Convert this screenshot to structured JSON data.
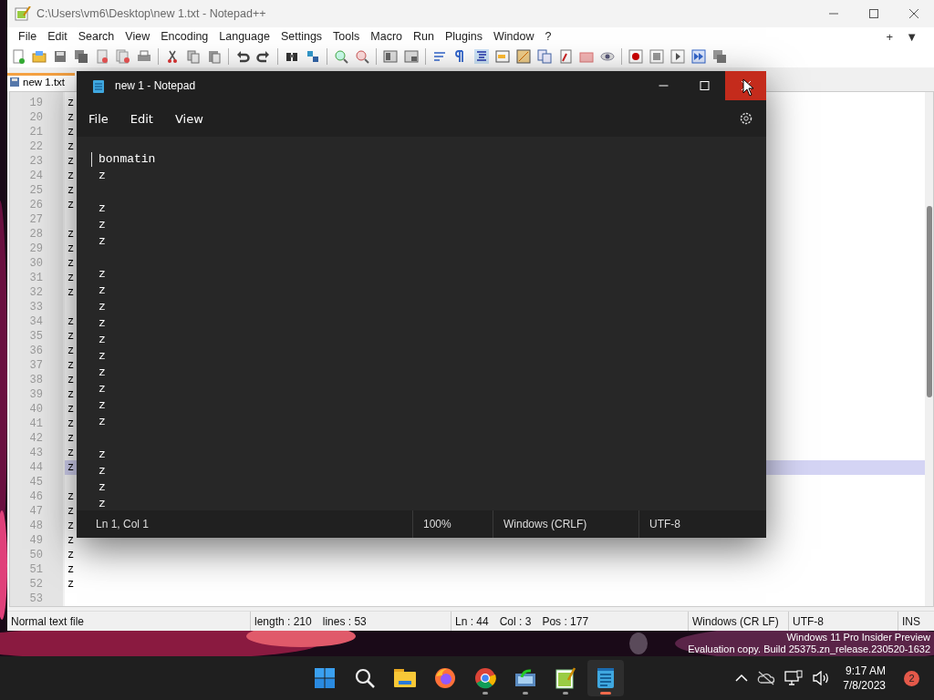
{
  "notepadpp": {
    "title": "C:\\Users\\vm6\\Desktop\\new 1.txt - Notepad++",
    "menu": [
      "File",
      "Edit",
      "Search",
      "View",
      "Encoding",
      "Language",
      "Settings",
      "Tools",
      "Macro",
      "Run",
      "Plugins",
      "Window",
      "?"
    ],
    "menu_right": [
      "+",
      "▼"
    ],
    "tabs": [
      {
        "label": "new 1.txt",
        "selected": true
      }
    ],
    "lines": [
      {
        "number": "19",
        "text": "z",
        "current": false
      },
      {
        "number": "20",
        "text": "z",
        "current": false
      },
      {
        "number": "21",
        "text": "z",
        "current": false
      },
      {
        "number": "22",
        "text": "z",
        "current": false
      },
      {
        "number": "23",
        "text": "z",
        "current": false
      },
      {
        "number": "24",
        "text": "z",
        "current": false
      },
      {
        "number": "25",
        "text": "z",
        "current": false
      },
      {
        "number": "26",
        "text": "z",
        "current": false
      },
      {
        "number": "27",
        "current": false
      },
      {
        "number": "28",
        "text": "z",
        "current": false
      },
      {
        "number": "29",
        "text": "z",
        "current": false
      },
      {
        "number": "30",
        "text": "z",
        "current": false
      },
      {
        "number": "31",
        "text": "z",
        "current": false
      },
      {
        "number": "32",
        "text": "z",
        "current": false
      },
      {
        "number": "33",
        "current": false
      },
      {
        "number": "34",
        "text": "z",
        "current": false
      },
      {
        "number": "35",
        "text": "z",
        "current": false
      },
      {
        "number": "36",
        "text": "z",
        "current": false
      },
      {
        "number": "37",
        "text": "z",
        "current": false
      },
      {
        "number": "38",
        "text": "z",
        "current": false
      },
      {
        "number": "39",
        "text": "z",
        "current": false
      },
      {
        "number": "40",
        "text": "z",
        "current": false
      },
      {
        "number": "41",
        "text": "z",
        "current": false
      },
      {
        "number": "42",
        "text": "z",
        "current": false
      },
      {
        "number": "43",
        "text": "z",
        "current": false
      },
      {
        "number": "44",
        "text": "z",
        "current": true
      },
      {
        "number": "45",
        "current": false
      },
      {
        "number": "46",
        "text": "z",
        "current": false
      },
      {
        "number": "47",
        "text": "z",
        "current": false
      },
      {
        "number": "48",
        "text": "z",
        "current": false
      },
      {
        "number": "49",
        "text": "z",
        "current": false
      },
      {
        "number": "50",
        "text": "z",
        "current": false
      },
      {
        "number": "51",
        "text": "z",
        "current": false
      },
      {
        "number": "52",
        "text": "z",
        "current": false
      },
      {
        "number": "53",
        "current": false
      }
    ],
    "status_bar": {
      "file_type": "Normal text file",
      "length": "length : 210",
      "lines": "lines : 53",
      "ln": "Ln : 44",
      "col": "Col : 3",
      "pos": "Pos : 177",
      "eol": "Windows (CR LF)",
      "encoding": "UTF-8",
      "mode": "INS"
    }
  },
  "notepad": {
    "title": "new 1 - Notepad",
    "close_hovered": true,
    "menu": [
      "File",
      "Edit",
      "View"
    ],
    "lines": [
      {
        "kind": "text",
        "text": "bonmatin"
      },
      {
        "kind": "text",
        "text": "z"
      },
      {
        "kind": "blank"
      },
      {
        "kind": "text",
        "text": "z"
      },
      {
        "kind": "text",
        "text": "z"
      },
      {
        "kind": "text",
        "text": "z"
      },
      {
        "kind": "blank"
      },
      {
        "kind": "text",
        "text": "z"
      },
      {
        "kind": "text",
        "text": "z"
      },
      {
        "kind": "text",
        "text": "z"
      },
      {
        "kind": "text",
        "text": "z"
      },
      {
        "kind": "text",
        "text": "z"
      },
      {
        "kind": "text",
        "text": "z"
      },
      {
        "kind": "text",
        "text": "z"
      },
      {
        "kind": "text",
        "text": "z"
      },
      {
        "kind": "text",
        "text": "z"
      },
      {
        "kind": "text",
        "text": "z"
      },
      {
        "kind": "blank"
      },
      {
        "kind": "text",
        "text": "z"
      },
      {
        "kind": "text",
        "text": "z"
      },
      {
        "kind": "text",
        "text": "z"
      },
      {
        "kind": "text",
        "text": "z"
      }
    ],
    "status_bar": {
      "position": "Ln 1, Col 1",
      "zoom": "100%",
      "eol": "Windows (CRLF)",
      "encoding": "UTF-8"
    }
  },
  "desktop": {
    "watermark": [
      "Windows 11 Pro Insider Preview",
      "Evaluation copy. Build 25375.zn_release.230520-1632"
    ]
  },
  "taskbar": {
    "apps": [
      {
        "kind": "start",
        "running": false,
        "selected": false
      },
      {
        "kind": "search",
        "running": false,
        "selected": false
      },
      {
        "kind": "explorer",
        "running": false,
        "selected": false
      },
      {
        "kind": "firefox",
        "running": false,
        "selected": false
      },
      {
        "kind": "chrome",
        "running": true,
        "selected": false
      },
      {
        "kind": "app",
        "running": true,
        "selected": false
      },
      {
        "kind": "notepadpp",
        "running": true,
        "selected": false
      },
      {
        "kind": "notepad",
        "running": true,
        "selected": true
      }
    ],
    "time": "9:17 AM",
    "date": "7/8/2023",
    "notifications": "2"
  }
}
